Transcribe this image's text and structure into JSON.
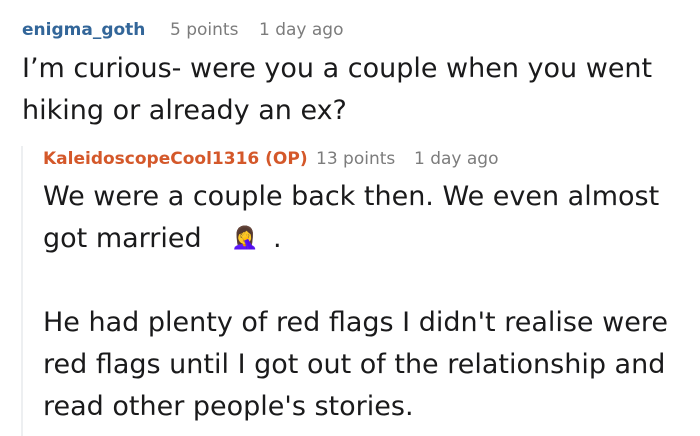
{
  "comments": [
    {
      "username": "enigma_goth",
      "points": "5 points",
      "time": "1 day ago",
      "lines": [
        "I’m curious- were you a couple when you went",
        "hiking or already an ex?"
      ],
      "username_color": "#336699"
    },
    {
      "username": "KaleidoscopeCool1316 (OP)",
      "points": "13 points",
      "time": "1 day ago",
      "lines": [
        "We were a couple back then. We even almost",
        "got married",
        "He had plenty of red flags I didn't realise were",
        "red flags until I got out of the relationship and",
        "read other people's stories."
      ],
      "emoji": "🤦‍♀️",
      "trailing": ".",
      "username_color": "#d4582a"
    }
  ]
}
